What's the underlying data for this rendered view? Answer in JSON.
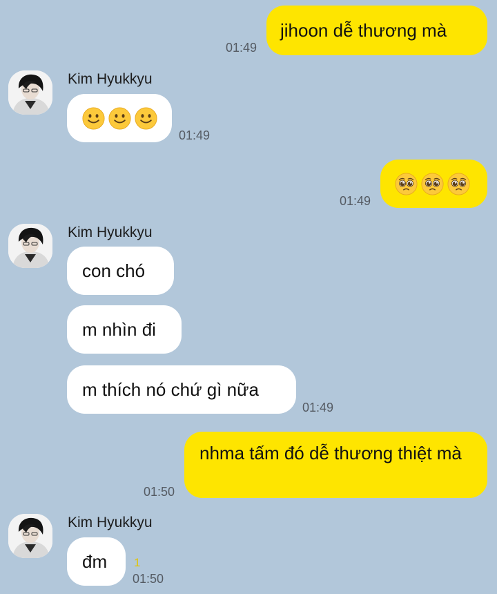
{
  "contact": {
    "name": "Kim Hyukkyu",
    "avatar_icon": "profile-photo-icon"
  },
  "colors": {
    "background": "#b2c7da",
    "outgoing_bubble": "#fee500",
    "incoming_bubble": "#ffffff",
    "unread_count": "#e2c400"
  },
  "messages": [
    {
      "direction": "outgoing",
      "text": "jihoon dễ thương mà",
      "time": "01:49"
    },
    {
      "direction": "incoming",
      "sender": "Kim Hyukkyu",
      "emoji": [
        "slightly-smiling-face-icon",
        "slightly-smiling-face-icon",
        "slightly-smiling-face-icon"
      ],
      "time": "01:49"
    },
    {
      "direction": "outgoing",
      "emoji": [
        "pleading-face-icon",
        "pleading-face-icon",
        "pleading-face-icon"
      ],
      "time": "01:49"
    },
    {
      "direction": "incoming",
      "sender": "Kim Hyukkyu",
      "text": "con chó"
    },
    {
      "direction": "incoming",
      "text": "m nhìn đi"
    },
    {
      "direction": "incoming",
      "text": "m thích nó chứ gì nữa",
      "time": "01:49"
    },
    {
      "direction": "outgoing",
      "text": "nhma tấm đó dễ thương thiệt mà",
      "time": "01:50"
    },
    {
      "direction": "incoming",
      "sender": "Kim Hyukkyu",
      "text": "đm",
      "unread": "1",
      "time": "01:50"
    }
  ]
}
